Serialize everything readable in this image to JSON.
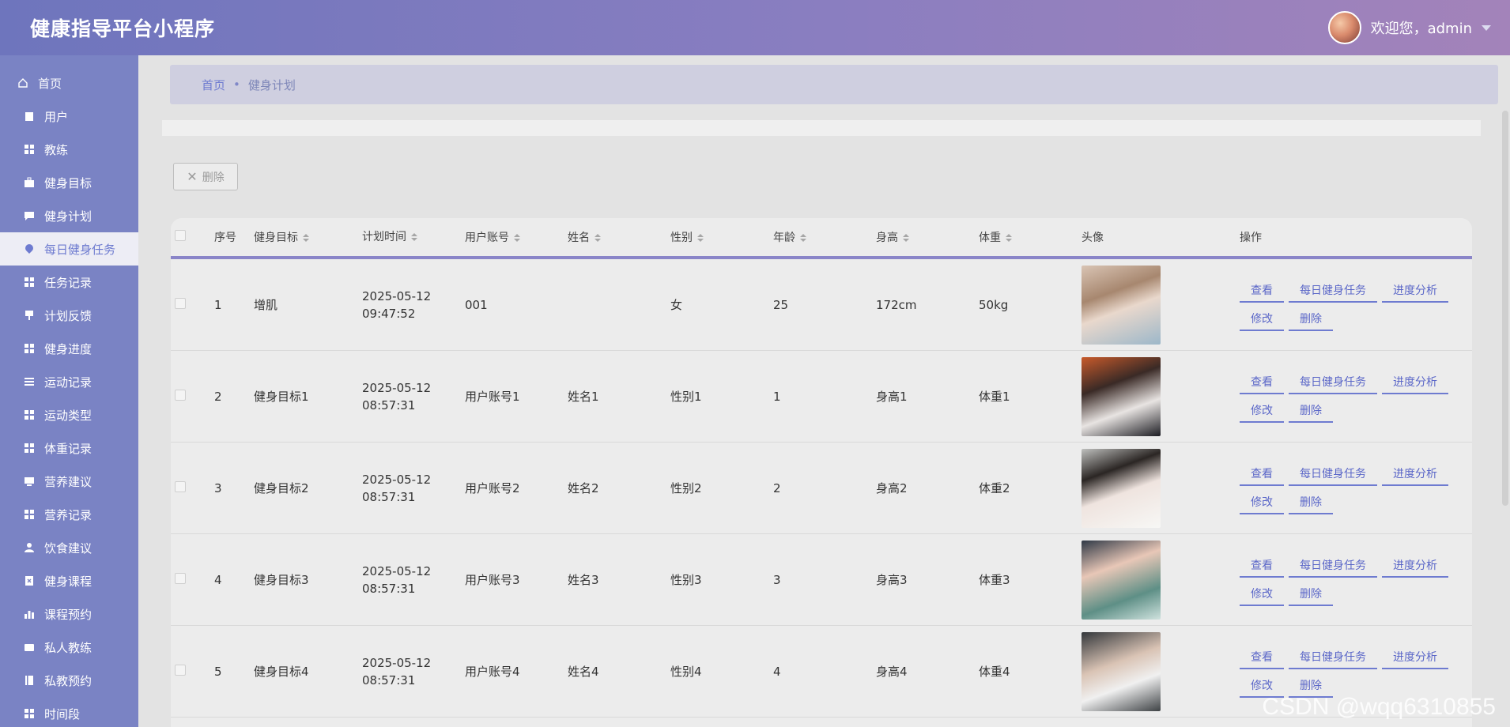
{
  "header": {
    "title": "健康指导平台小程序",
    "welcome": "欢迎您，admin"
  },
  "sidebar": {
    "items": [
      {
        "label": "首页",
        "icon": "home-icon"
      },
      {
        "label": "用户",
        "icon": "clipboard-icon"
      },
      {
        "label": "教练",
        "icon": "grid-icon"
      },
      {
        "label": "健身目标",
        "icon": "briefcase-icon"
      },
      {
        "label": "健身计划",
        "icon": "chat-icon"
      },
      {
        "label": "每日健身任务",
        "icon": "location-icon"
      },
      {
        "label": "任务记录",
        "icon": "grid-icon"
      },
      {
        "label": "计划反馈",
        "icon": "pin-icon"
      },
      {
        "label": "健身进度",
        "icon": "grid-icon"
      },
      {
        "label": "运动记录",
        "icon": "list-icon"
      },
      {
        "label": "运动类型",
        "icon": "grid-icon"
      },
      {
        "label": "体重记录",
        "icon": "grid-icon"
      },
      {
        "label": "营养建议",
        "icon": "monitor-icon"
      },
      {
        "label": "营养记录",
        "icon": "grid-icon"
      },
      {
        "label": "饮食建议",
        "icon": "user-icon"
      },
      {
        "label": "健身课程",
        "icon": "clipboard-x-icon"
      },
      {
        "label": "课程预约",
        "icon": "chart-icon"
      },
      {
        "label": "私人教练",
        "icon": "wallet-icon"
      },
      {
        "label": "私教预约",
        "icon": "book-icon"
      },
      {
        "label": "时间段",
        "icon": "grid-icon"
      }
    ]
  },
  "breadcrumb": {
    "home": "首页",
    "separator": "•",
    "current": "健身计划"
  },
  "toolbar": {
    "delete_label": "删除"
  },
  "table": {
    "headers": [
      "序号",
      "健身目标",
      "计划时间",
      "用户账号",
      "姓名",
      "性别",
      "年龄",
      "身高",
      "体重",
      "头像",
      "操作"
    ],
    "rows": [
      {
        "idx": "1",
        "goal": "增肌",
        "time": "2025-05-12 09:47:52",
        "account": "001",
        "name": "",
        "sex": "女",
        "age": "25",
        "height": "172cm",
        "weight": "50kg"
      },
      {
        "idx": "2",
        "goal": "健身目标1",
        "time": "2025-05-12 08:57:31",
        "account": "用户账号1",
        "name": "姓名1",
        "sex": "性别1",
        "age": "1",
        "height": "身高1",
        "weight": "体重1"
      },
      {
        "idx": "3",
        "goal": "健身目标2",
        "time": "2025-05-12 08:57:31",
        "account": "用户账号2",
        "name": "姓名2",
        "sex": "性别2",
        "age": "2",
        "height": "身高2",
        "weight": "体重2"
      },
      {
        "idx": "4",
        "goal": "健身目标3",
        "time": "2025-05-12 08:57:31",
        "account": "用户账号3",
        "name": "姓名3",
        "sex": "性别3",
        "age": "3",
        "height": "身高3",
        "weight": "体重3"
      },
      {
        "idx": "5",
        "goal": "健身目标4",
        "time": "2025-05-12 08:57:31",
        "account": "用户账号4",
        "name": "姓名4",
        "sex": "性别4",
        "age": "4",
        "height": "身高4",
        "weight": "体重4"
      }
    ],
    "ops": {
      "view": "查看",
      "daily": "每日健身任务",
      "analysis": "进度分析",
      "edit": "修改",
      "delete": "删除"
    }
  },
  "watermark": "CSDN @wqq6310855",
  "colors": {
    "header_start": "#6e75bd",
    "header_end": "#a383ba",
    "sidebar": "#7a83c4",
    "accent": "#6e7bd0"
  }
}
